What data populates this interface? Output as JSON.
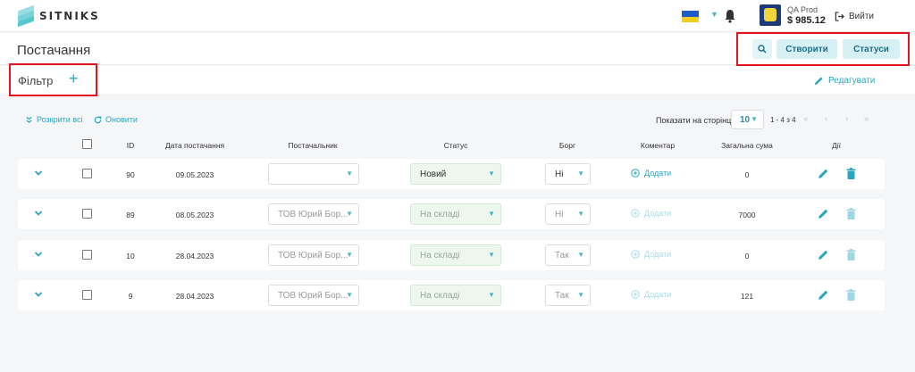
{
  "app": {
    "brand": "SITNIKS"
  },
  "topbar": {
    "user_name": "QA Prod",
    "balance": "$ 985.12",
    "logout_label": "Вийти"
  },
  "page": {
    "title": "Постачання"
  },
  "actions": {
    "create_label": "Створити",
    "statuses_label": "Статуси"
  },
  "filter": {
    "label": "Фільтр",
    "add_symbol": "+",
    "edit_label": "Редагувати"
  },
  "toolbar": {
    "expand_all": "Розкрити всі",
    "refresh": "Оновити",
    "per_page_label": "Показати на сторінці",
    "per_page_value": "10",
    "range": "1 - 4 з 4",
    "pager": {
      "first": "«",
      "prev": "‹",
      "next": "›",
      "last": "»"
    }
  },
  "columns": {
    "id": "ID",
    "date": "Дата постачання",
    "supplier": "Постачальник",
    "status": "Статус",
    "debt": "Борг",
    "comment": "Коментар",
    "total": "Загальна сума",
    "actions": "Дії"
  },
  "rows": [
    {
      "id": "90",
      "date": "09.05.2023",
      "supplier": "",
      "status": "Новий",
      "debt": "Ні",
      "comment": "Додати",
      "total": "0"
    },
    {
      "id": "89",
      "date": "08.05.2023",
      "supplier": "ТОВ Юрий Бор...",
      "status": "На складі",
      "debt": "Ні",
      "comment": "Додати",
      "total": "7000"
    },
    {
      "id": "10",
      "date": "28.04.2023",
      "supplier": "ТОВ Юрий Бор...",
      "status": "На складі",
      "debt": "Так",
      "comment": "Додати",
      "total": "0"
    },
    {
      "id": "9",
      "date": "28.04.2023",
      "supplier": "ТОВ Юрий Бор...",
      "status": "На складі",
      "debt": "Так",
      "comment": "Додати",
      "total": "121"
    }
  ],
  "colors": {
    "accent": "#2aa6bf",
    "highlight_border": "#e3141b",
    "status_bg": "#eef7ee"
  }
}
